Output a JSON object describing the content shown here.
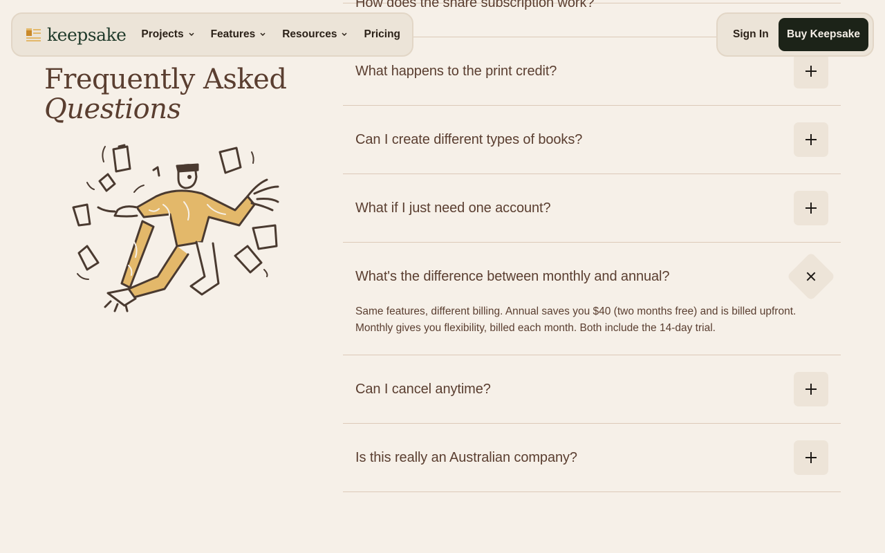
{
  "nav": {
    "brand": "keepsake",
    "items": [
      {
        "label": "Projects",
        "has_menu": true
      },
      {
        "label": "Features",
        "has_menu": true
      },
      {
        "label": "Resources",
        "has_menu": true
      },
      {
        "label": "Pricing",
        "has_menu": false
      }
    ],
    "sign_in": "Sign In",
    "cta": "Buy Keepsake"
  },
  "heading": {
    "line1": "Frequently Asked",
    "line2": "Questions"
  },
  "illustration": {
    "icon": "juggling-person-illustration"
  },
  "faq": [
    {
      "question": "How does the share subscription work?",
      "open": false
    },
    {
      "question": "What happens to the print credit?",
      "open": false
    },
    {
      "question": "Can I create different types of books?",
      "open": false
    },
    {
      "question": "What if I just need one account?",
      "open": false
    },
    {
      "question": "What's the difference between monthly and annual?",
      "open": true,
      "answer": "Same features, different billing. Annual saves you $40 (two months free) and is billed upfront. Monthly gives you flexibility, billed each month. Both include the 14-day trial."
    },
    {
      "question": "Can I cancel anytime?",
      "open": false
    },
    {
      "question": "Is this really an Australian company?",
      "open": false
    }
  ],
  "colors": {
    "background": "#f6f0e8",
    "text": "#5a3e30",
    "brand": "#1f3a2a",
    "cta": "#1c2318",
    "accent": "#e3b86a"
  }
}
